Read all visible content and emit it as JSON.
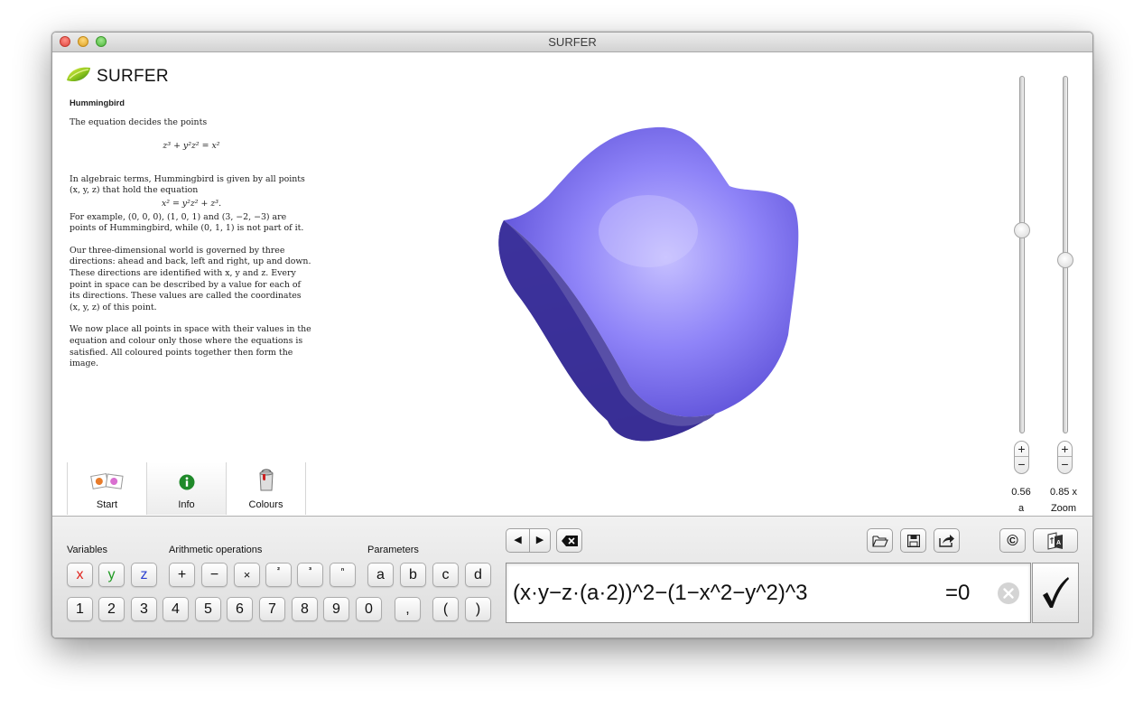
{
  "window": {
    "title": "SURFER"
  },
  "app": {
    "logo_text": "SURFER"
  },
  "info": {
    "heading": "Hummingbird",
    "p1": "The equation decides the points",
    "eq1": "z³ + y²z² = x²",
    "p2": "In algebraic terms, Hummingbird is given by all points (x, y, z) that hold the equation",
    "eq2": "x² = y²z² + z³.",
    "p3": "For example, (0, 0, 0), (1, 0, 1) and (3, −2, −3) are points of Hummingbird, while (0, 1, 1) is not part of it.",
    "p4": "Our three-dimensional world is governed by three directions: ahead and back, left and right, up and down. These directions are identified with x, y and z. Every point in space can be described by a value for each of its directions. These values are called the coordinates (x, y, z) of this point.",
    "p5": "We now place all points in space with their values in the equation and colour only those where the equations is satisfied. All coloured points together then form the image."
  },
  "tabs": [
    {
      "label": "Start",
      "icon": "gallery-icon"
    },
    {
      "label": "Info",
      "icon": "info-icon",
      "active": true
    },
    {
      "label": "Colours",
      "icon": "paint-bucket-icon"
    }
  ],
  "sliders": {
    "a": {
      "value_text": "0.56",
      "label": "a",
      "level": 0.44
    },
    "zoom": {
      "value_text": "0.85 x",
      "label": "Zoom",
      "level": 0.52
    },
    "plus": "+",
    "minus": "−"
  },
  "keyboard": {
    "variables_label": "Variables",
    "arithmetic_label": "Arithmetic operations",
    "parameters_label": "Parameters",
    "variables": [
      "x",
      "y",
      "z"
    ],
    "variable_colors": [
      "#e0231c",
      "#1f9a22",
      "#2b3fd0"
    ],
    "operations": [
      "+",
      "−",
      "×",
      "²",
      "³",
      "ⁿ"
    ],
    "parameters": [
      "a",
      "b",
      "c",
      "d"
    ],
    "digits": [
      "1",
      "2",
      "3",
      "4",
      "5",
      "6",
      "7",
      "8",
      "9",
      "0"
    ],
    "punct": [
      ",",
      "(",
      ")"
    ]
  },
  "toolbar": {
    "left_arrow": "◀",
    "right_arrow": "▶",
    "open": "folder-open-icon",
    "save": "save-icon",
    "share": "share-icon",
    "copyright": "©",
    "language": "translate-icon"
  },
  "formula": {
    "text": "(x·y−z·(a·2))^2−(1−x^2−y^2)^3",
    "equals": "=0",
    "apply_label": "✓"
  },
  "colors": {
    "surface_main": "#7b6cf0",
    "surface_dark": "#3c318f",
    "surface_light": "#c6c0ff"
  }
}
